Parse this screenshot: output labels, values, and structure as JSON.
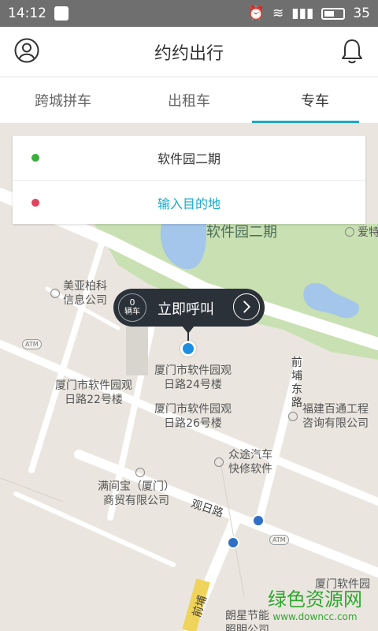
{
  "status_bar": {
    "time": "14:12",
    "battery": "35"
  },
  "header": {
    "title": "约约出行"
  },
  "tabs": [
    {
      "label": "跨城拼车"
    },
    {
      "label": "出租车"
    },
    {
      "label": "专车",
      "active": true
    }
  ],
  "address": {
    "from": "软件园二期",
    "to": "输入目的地"
  },
  "call": {
    "count": "0",
    "unit": "辆车",
    "label": "立即呼叫"
  },
  "map_labels": {
    "park": "软件园二期",
    "aite": "爱特",
    "meiya_1": "美亚柏科",
    "meiya_2": "信息公司",
    "bldg24_1": "厦门市软件园观",
    "bldg24_2": "日路24号楼",
    "bldg22_1": "厦门市软件园观",
    "bldg22_2": "日路22号楼",
    "bldg26_1": "厦门市软件园观",
    "bldg26_2": "日路26号楼",
    "qianpu_road_v": "前埔东路",
    "baitong_1": "福建百通工程",
    "baitong_2": "咨询有限公司",
    "zhongtu_1": "众途汽车",
    "zhongtu_2": "快修软件",
    "manjian_1": "满间宝（厦门）",
    "manjian_2": "商贸有限公司",
    "guanri_road": "观日路",
    "xiamen_soft": "厦门软件园",
    "qianpu_bottom": "前埔",
    "langxing_1": "朗星节能",
    "langxing_2": "照明公司",
    "atm": "ATM"
  },
  "watermark": {
    "line1": "绿色资源网",
    "line2": "www.downcc.com"
  },
  "colors": {
    "accent": "#1aa9c9",
    "from_dot": "#3cae3c",
    "to_dot": "#e0435e",
    "bubble": "#2b3138",
    "pin": "#1e8fe0"
  }
}
